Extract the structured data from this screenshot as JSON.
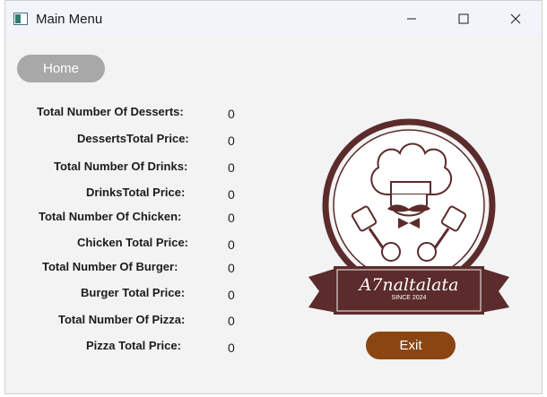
{
  "window": {
    "title": "Main Menu"
  },
  "nav": {
    "home_label": "Home"
  },
  "stats": [
    {
      "label": "Total Number Of Desserts:",
      "value": "0"
    },
    {
      "label": "DessertsTotal Price:",
      "value": "0"
    },
    {
      "label": "Total Number Of Drinks:",
      "value": "0"
    },
    {
      "label": "DrinksTotal Price:",
      "value": "0"
    },
    {
      "label": "Total Number Of Chicken:",
      "value": "0"
    },
    {
      "label": "Chicken Total Price:",
      "value": "0"
    },
    {
      "label": "Total Number Of Burger:",
      "value": "0"
    },
    {
      "label": "Burger Total Price:",
      "value": "0"
    },
    {
      "label": "Total Number Of Pizza:",
      "value": "0"
    },
    {
      "label": "Pizza Total Price:",
      "value": "0"
    }
  ],
  "logo": {
    "brand_name": "A7naltalata",
    "since_text": "SINCE 2024",
    "icon": "chef-logo-icon"
  },
  "actions": {
    "exit_label": "Exit"
  },
  "colors": {
    "logo_brown": "#5c2b2b",
    "exit_button": "#8b4513",
    "home_button": "#a8a8a8"
  }
}
